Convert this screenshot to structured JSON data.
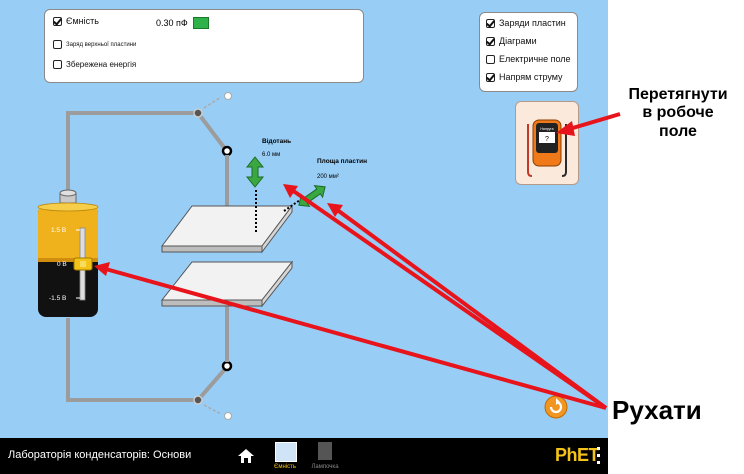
{
  "meters": {
    "capacitance": {
      "label": "Ємність",
      "checked": true,
      "value": "0.30 пФ"
    },
    "top_plate_charge": {
      "label": "Заряд верхньої пластини",
      "checked": false
    },
    "stored_energy": {
      "label": "Збережена енергія",
      "checked": false
    }
  },
  "view": {
    "plate_charges": {
      "label": "Заряди пластин",
      "checked": true
    },
    "bar_graphs": {
      "label": "Діаграми",
      "checked": true
    },
    "electric_field": {
      "label": "Електричне поле",
      "checked": false
    },
    "current_direction": {
      "label": "Напрям струму",
      "checked": true
    }
  },
  "voltmeter": {
    "label": "Напруга",
    "reading": "?"
  },
  "separation": {
    "label": "Відотань",
    "value": "6.0 мм"
  },
  "plate_area": {
    "label": "Площа пластин",
    "value": "200 мм²"
  },
  "battery": {
    "top_label": "1.5 В",
    "mid_label": "0 В",
    "bottom_label": "-1.5 В",
    "level": 0.5
  },
  "annotations": {
    "drag_line1": "Перетягнути",
    "drag_line2": "в робоче",
    "drag_line3": "поле",
    "move": "Рухати"
  },
  "navbar": {
    "title": "Лабораторія конденсаторів: Основи",
    "home_icon": "home-icon",
    "tabs": [
      {
        "label": "Ємність",
        "active": true
      },
      {
        "label": "Лампочка",
        "active": false
      }
    ],
    "logo": "PhET"
  },
  "colors": {
    "background": "#98cdf6",
    "accent": "#f3c318",
    "arrow": "#e8141c",
    "handle": "#3aa840"
  }
}
